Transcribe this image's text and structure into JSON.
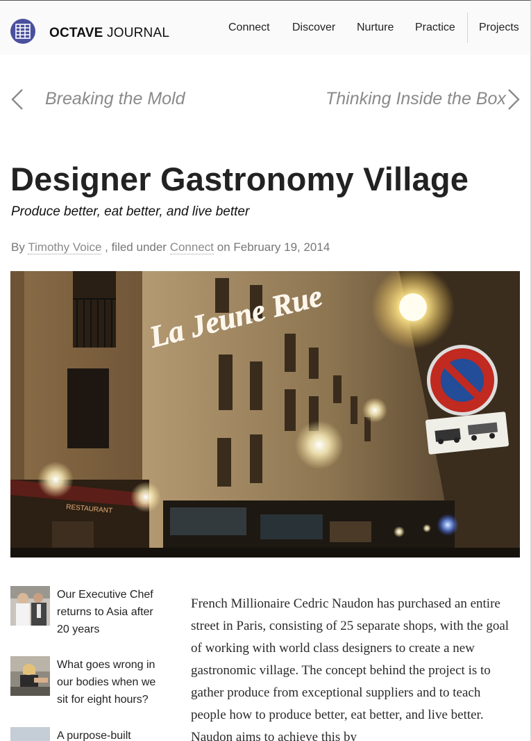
{
  "header": {
    "brand_bold": "OCTAVE",
    "brand_light": " JOURNAL",
    "nav": [
      "Connect",
      "Discover",
      "Nurture",
      "Practice",
      "Projects"
    ]
  },
  "pager": {
    "prev": "Breaking the Mold",
    "next": "Thinking Inside the Box"
  },
  "article": {
    "title": "Designer Gastronomy Village",
    "subtitle": "Produce better, eat better, and live better",
    "byline_prefix": "By ",
    "author": "Timothy Voice",
    "filed_under": " , filed under ",
    "category": "Connect",
    "date_text": " on February 19, 2014",
    "body": "French Millionaire Cedric Naudon has purchased an entire street in Paris, consisting of 25 separate shops, with the goal of working with world class designers to create a new gastronomic village. The concept behind the project is to gather produce from exceptional suppliers and to teach people how to produce better, eat better, and live better. Naudon aims to achieve this by"
  },
  "hero": {
    "sign_text": "La Jeune Rue",
    "awning_text": "RESTAURANT"
  },
  "related": [
    {
      "title": "Our Executive Chef returns to Asia after 20 years"
    },
    {
      "title": "What goes wrong in our bodies when we sit for eight hours?"
    },
    {
      "title": "A purpose-built"
    }
  ],
  "colors": {
    "logo": "#4a4f9e",
    "muted": "#8a8a8a",
    "text": "#222222"
  }
}
